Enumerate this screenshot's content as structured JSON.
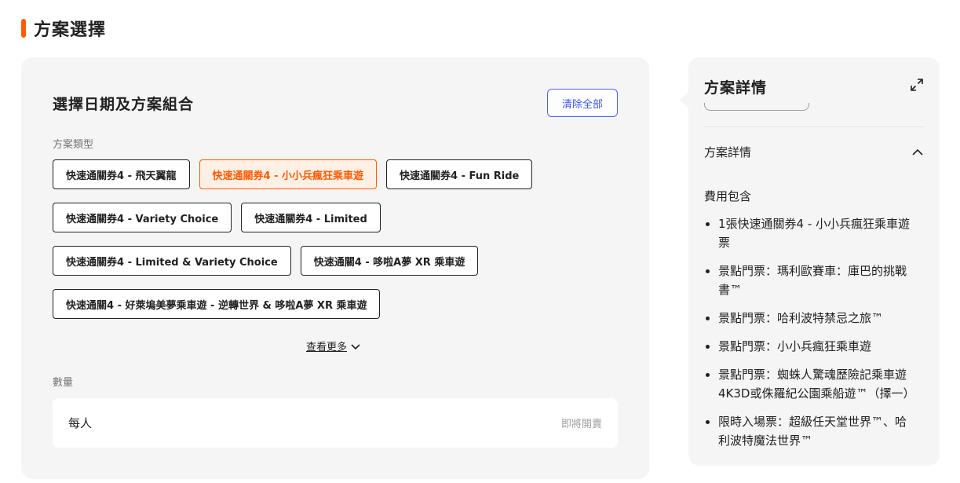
{
  "section": {
    "title": "方案選擇"
  },
  "selector": {
    "title": "選擇日期及方案組合",
    "clear_label": "清除全部",
    "type_label": "方案類型",
    "options": [
      {
        "label": "快速通關券4 - 飛天翼龍",
        "selected": false
      },
      {
        "label": "快速通關券4 - 小小兵瘋狂乘車遊",
        "selected": true
      },
      {
        "label": "快速通關券4 - Fun Ride",
        "selected": false
      },
      {
        "label": "快速通關券4 - Variety Choice",
        "selected": false
      },
      {
        "label": "快速通關券4 - Limited",
        "selected": false
      },
      {
        "label": "快速通關券4 - Limited & Variety Choice",
        "selected": false
      },
      {
        "label": "快速通關4 - 哆啦A夢 XR 乘車遊",
        "selected": false
      },
      {
        "label": "快速通關4 - 好萊塢美夢乘車遊 - 逆轉世界 & 哆啦A夢 XR 乘車遊",
        "selected": false
      }
    ],
    "more_label": "查看更多",
    "quantity_label": "數量",
    "quantity_row": {
      "label": "每人",
      "status": "即將開賣"
    }
  },
  "details": {
    "title": "方案詳情",
    "section_label": "方案詳情",
    "includes_label": "費用包含",
    "items": [
      "1張快速通關券4 - 小小兵瘋狂乘車遊票",
      "景點門票：瑪利歐賽車：庫巴的挑戰書™",
      "景點門票：哈利波特禁忌之旅™",
      "景點門票：小小兵瘋狂乘車遊",
      "景點門票：蜘蛛人驚魂歷險記乘車遊4K3D或侏羅紀公園乘船遊™（擇一）",
      "限時入場票：超級任天堂世界™、哈利波特魔法世界™"
    ]
  },
  "colors": {
    "accent": "#ff5b00",
    "link": "#3b56e6",
    "panel": "#f5f5f5"
  }
}
